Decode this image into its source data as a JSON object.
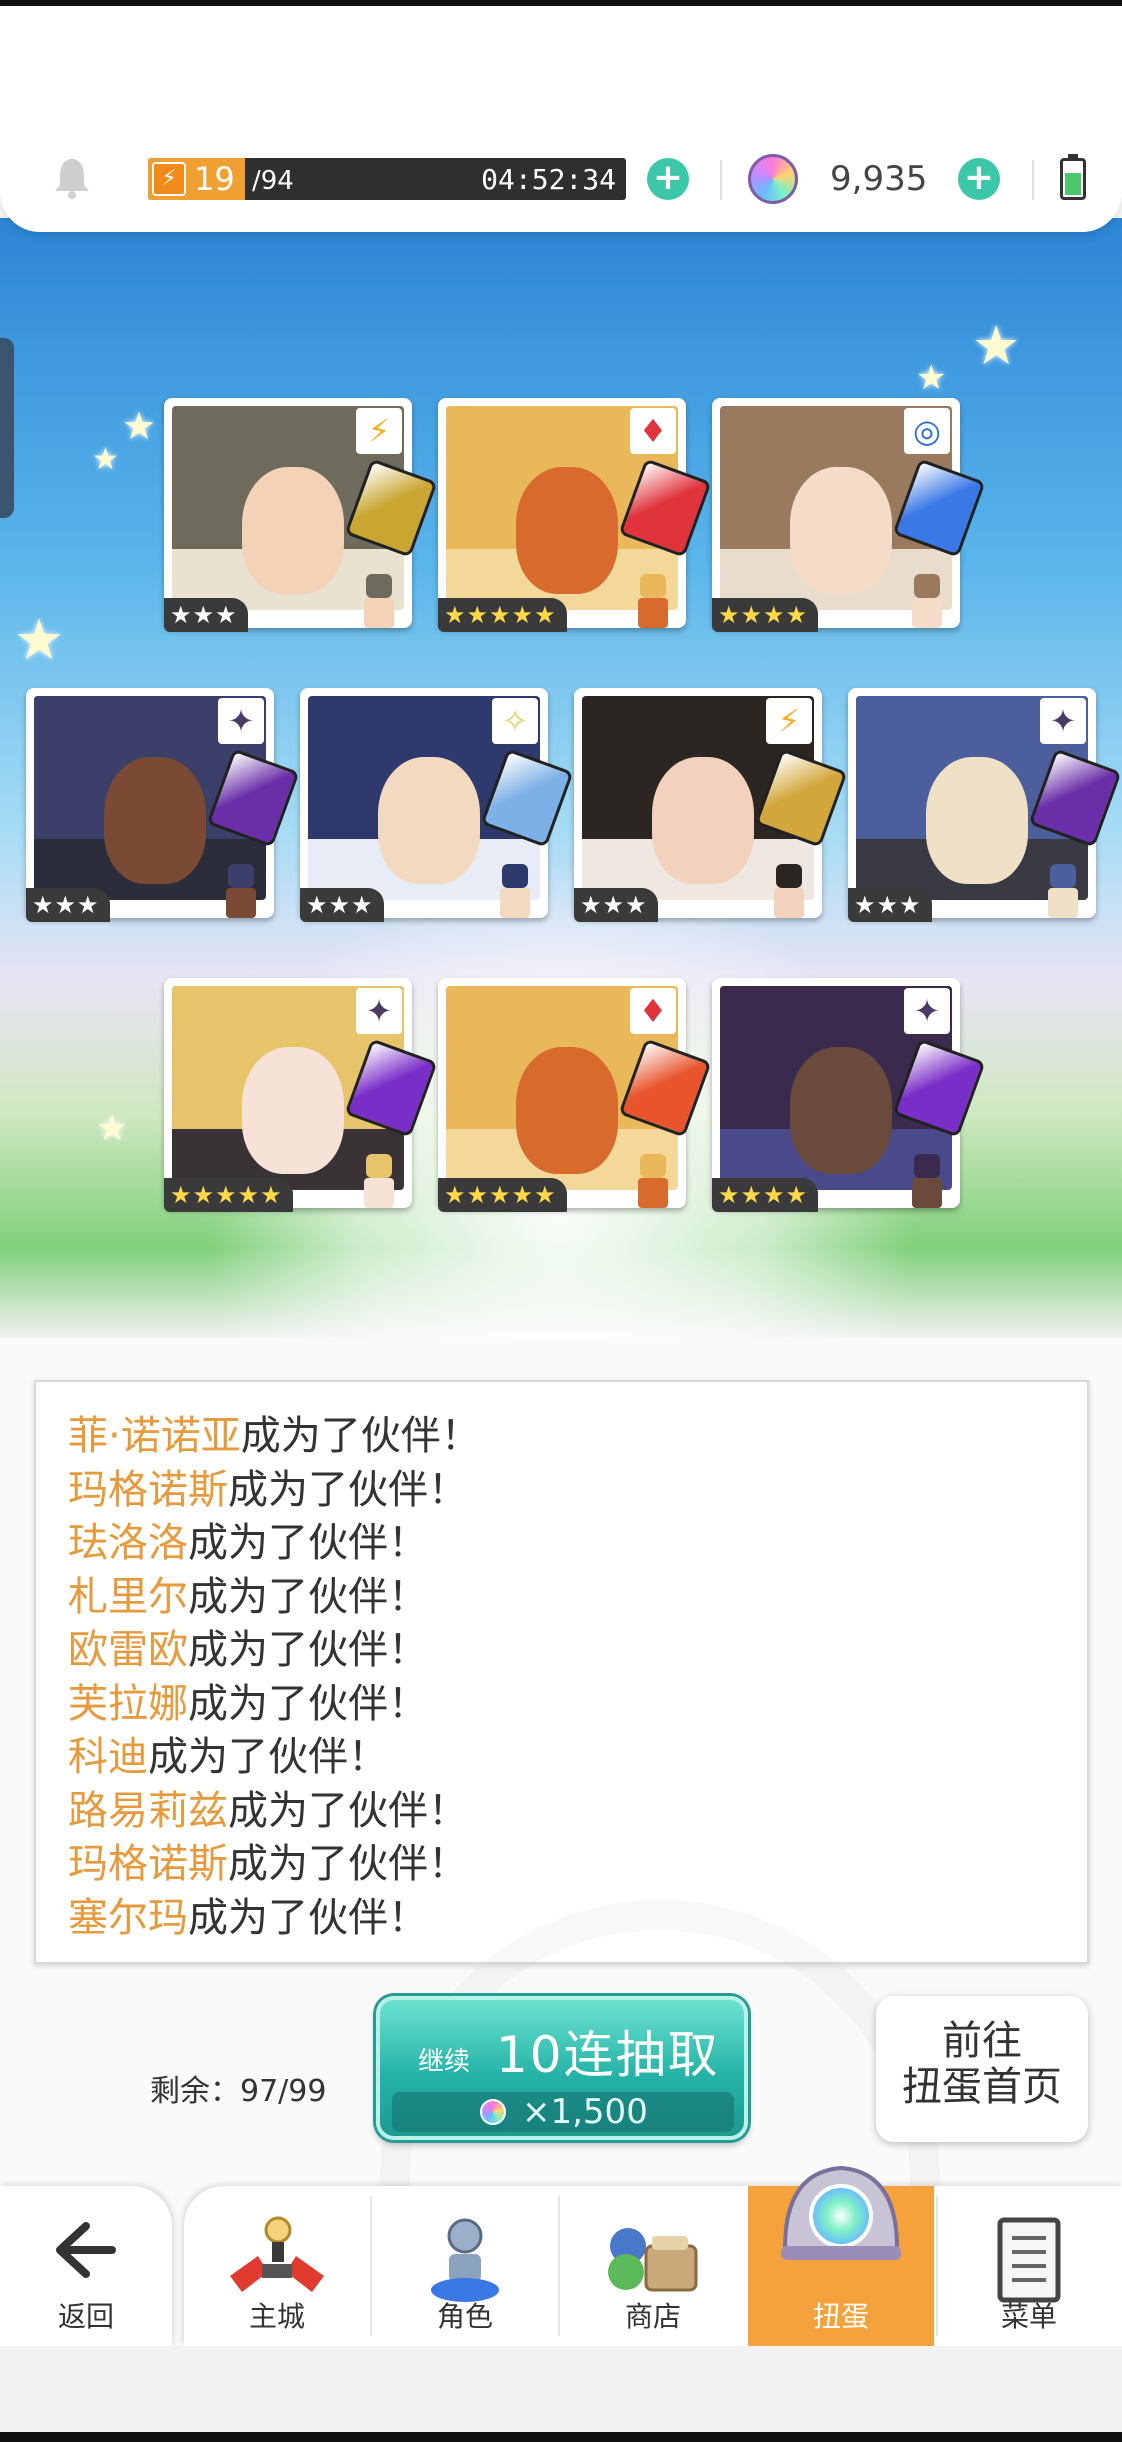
{
  "topbar": {
    "stamina_current": "19",
    "stamina_max": "/94",
    "stamina_fraction": 0.202,
    "timer": "04:52:34",
    "gems": "9,935",
    "battery_level": 0.6
  },
  "results": [
    {
      "stars": "★★★",
      "attr": "⚡",
      "attr_color": "#f2b01e",
      "rarity_gold": false,
      "hair": "#6e6a5c",
      "skin": "#f3d2b8",
      "weapon": "#c9a632",
      "bg": "#e9e2d0"
    },
    {
      "stars": "★★★★★",
      "attr": "♦",
      "attr_color": "#e0333c",
      "rarity_gold": true,
      "hair": "#e9b85a",
      "skin": "#d86a2e",
      "weapon": "#e0333c",
      "bg": "#f3d89a"
    },
    {
      "stars": "★★★★",
      "attr": "◎",
      "attr_color": "#2a6fe0",
      "rarity_gold": true,
      "hair": "#9a7a5e",
      "skin": "#f5dcc8",
      "weapon": "#3a78e6",
      "bg": "#e8dccd"
    },
    {
      "stars": "★★★",
      "attr": "✦",
      "attr_color": "#4a3a66",
      "rarity_gold": false,
      "hair": "#3b3f6a",
      "skin": "#7a4a34",
      "weapon": "#6a2ea8",
      "bg": "#2b2d3b"
    },
    {
      "stars": "★★★",
      "attr": "✧",
      "attr_color": "#d9d96a",
      "rarity_gold": false,
      "hair": "#2e3a6e",
      "skin": "#f3d9c0",
      "weapon": "#7db0e6",
      "bg": "#e7ecf6"
    },
    {
      "stars": "★★★",
      "attr": "⚡",
      "attr_color": "#f2b01e",
      "rarity_gold": false,
      "hair": "#2c2622",
      "skin": "#f3d2bd",
      "weapon": "#d2a63a",
      "bg": "#efe8e2"
    },
    {
      "stars": "★★★",
      "attr": "✦",
      "attr_color": "#4a3a66",
      "rarity_gold": false,
      "hair": "#4c5f9c",
      "skin": "#f0e1c6",
      "weapon": "#6a2ea8",
      "bg": "#3a3a44"
    },
    {
      "stars": "★★★★★",
      "attr": "✦",
      "attr_color": "#4a3a66",
      "rarity_gold": true,
      "hair": "#e7c46a",
      "skin": "#f6e2d6",
      "weapon": "#7a2ec8",
      "bg": "#3a3336"
    },
    {
      "stars": "★★★★★",
      "attr": "♦",
      "attr_color": "#e0333c",
      "rarity_gold": true,
      "hair": "#e9b85a",
      "skin": "#d86a2e",
      "weapon": "#e8542c",
      "bg": "#f3d89a"
    },
    {
      "stars": "★★★★",
      "attr": "✦",
      "attr_color": "#4a3a66",
      "rarity_gold": true,
      "hair": "#3a2a4e",
      "skin": "#6a4a3a",
      "weapon": "#7a2ec8",
      "bg": "#4a4a8a"
    }
  ],
  "log": {
    "suffix": "成为了伙伴！",
    "names": [
      "菲·诺诺亚",
      "玛格诺斯",
      "珐洛洛",
      "札里尔",
      "欧雷欧",
      "芙拉娜",
      "科迪",
      "路易莉兹",
      "玛格诺斯",
      "塞尔玛"
    ]
  },
  "gacha": {
    "remaining_label": "剩余：97/99",
    "continue_label": "继续",
    "pull_label": "10连抽取",
    "cost": "×1,500",
    "home_line1": "前往",
    "home_line2": "扭蛋首页"
  },
  "nav": {
    "back": "返回",
    "items": [
      "主城",
      "角色",
      "商店",
      "扭蛋",
      "菜单"
    ],
    "active_index": 3,
    "accent": "#f5a23c"
  },
  "colors": {
    "name_highlight": "#e69a3c",
    "teal": "#25b3a7"
  }
}
